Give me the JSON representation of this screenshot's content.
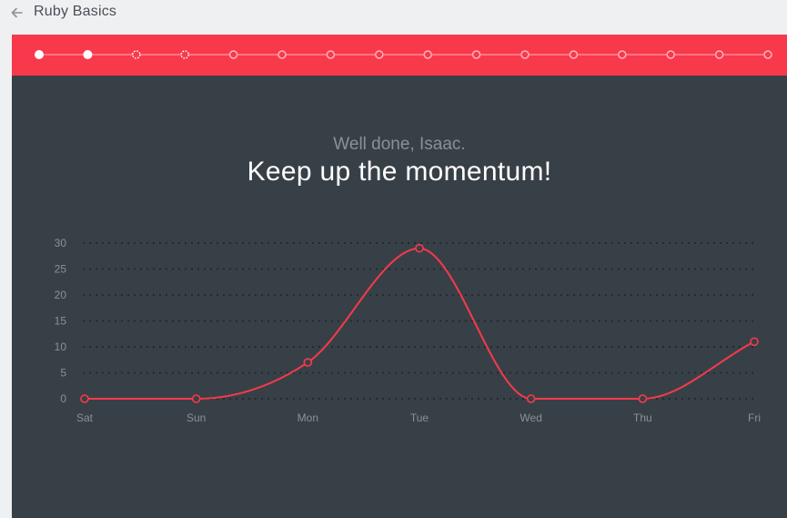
{
  "header": {
    "back_icon": "arrow-left-icon",
    "title": "Ruby Basics"
  },
  "progress": {
    "steps": [
      "complete",
      "complete",
      "in-progress",
      "in-progress",
      "pending",
      "pending",
      "pending",
      "pending",
      "pending",
      "pending",
      "pending",
      "pending",
      "pending",
      "pending",
      "pending",
      "pending"
    ],
    "colors": {
      "bar": "#f8394b",
      "complete": "#ffffff",
      "pending": "#ffb3ba"
    }
  },
  "message": {
    "subtitle": "Well done, Isaac.",
    "headline": "Keep up the momentum!"
  },
  "chart_data": {
    "type": "line",
    "smooth": true,
    "categories": [
      "Sat",
      "Sun",
      "Mon",
      "Tue",
      "Wed",
      "Thu",
      "Fri"
    ],
    "values": [
      0,
      0,
      7,
      29,
      0,
      0,
      11
    ],
    "yticks": [
      0,
      5,
      10,
      15,
      20,
      25,
      30
    ],
    "ylim": [
      0,
      30
    ],
    "grid": "dotted",
    "colors": {
      "line": "#f8394b",
      "marker_fill": "#384047",
      "grid": "#23292e",
      "tick": "#8a9096"
    }
  }
}
